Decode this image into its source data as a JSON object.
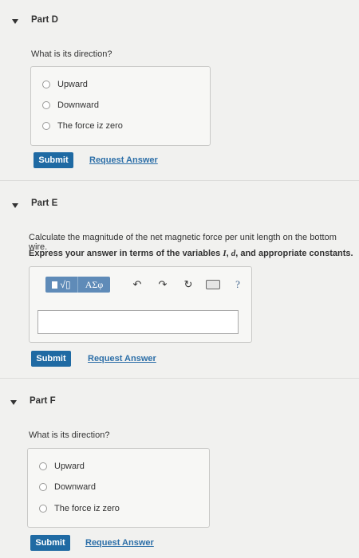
{
  "partD": {
    "title": "Part D",
    "question": "What is its direction?",
    "options": [
      "Upward",
      "Downward",
      "The force iz zero"
    ],
    "submit": "Submit",
    "request": "Request Answer"
  },
  "partE": {
    "title": "Part E",
    "question": "Calculate the magnitude of the net magnetic force per unit length on the bottom wire.",
    "instruction_prefix": "Express your answer in terms of the variables ",
    "var_I": "I",
    "sep1": ", ",
    "var_d": "d",
    "instruction_suffix": ", and appropriate constants.",
    "toolbar": {
      "templates_label": "√▯",
      "greek_label": "ΑΣφ",
      "undo_icon": "undo-icon",
      "redo_icon": "redo-icon",
      "reset_icon": "reset-icon",
      "keyboard_icon": "keyboard-icon",
      "help": "?"
    },
    "answer_value": "",
    "submit": "Submit",
    "request": "Request Answer"
  },
  "partF": {
    "title": "Part F",
    "question": "What is its direction?",
    "options": [
      "Upward",
      "Downward",
      "The force iz zero"
    ],
    "submit": "Submit",
    "request": "Request Answer"
  },
  "colors": {
    "accent": "#1f6aa3",
    "link": "#2d6fa8",
    "toolbar": "#5f8bb8"
  }
}
